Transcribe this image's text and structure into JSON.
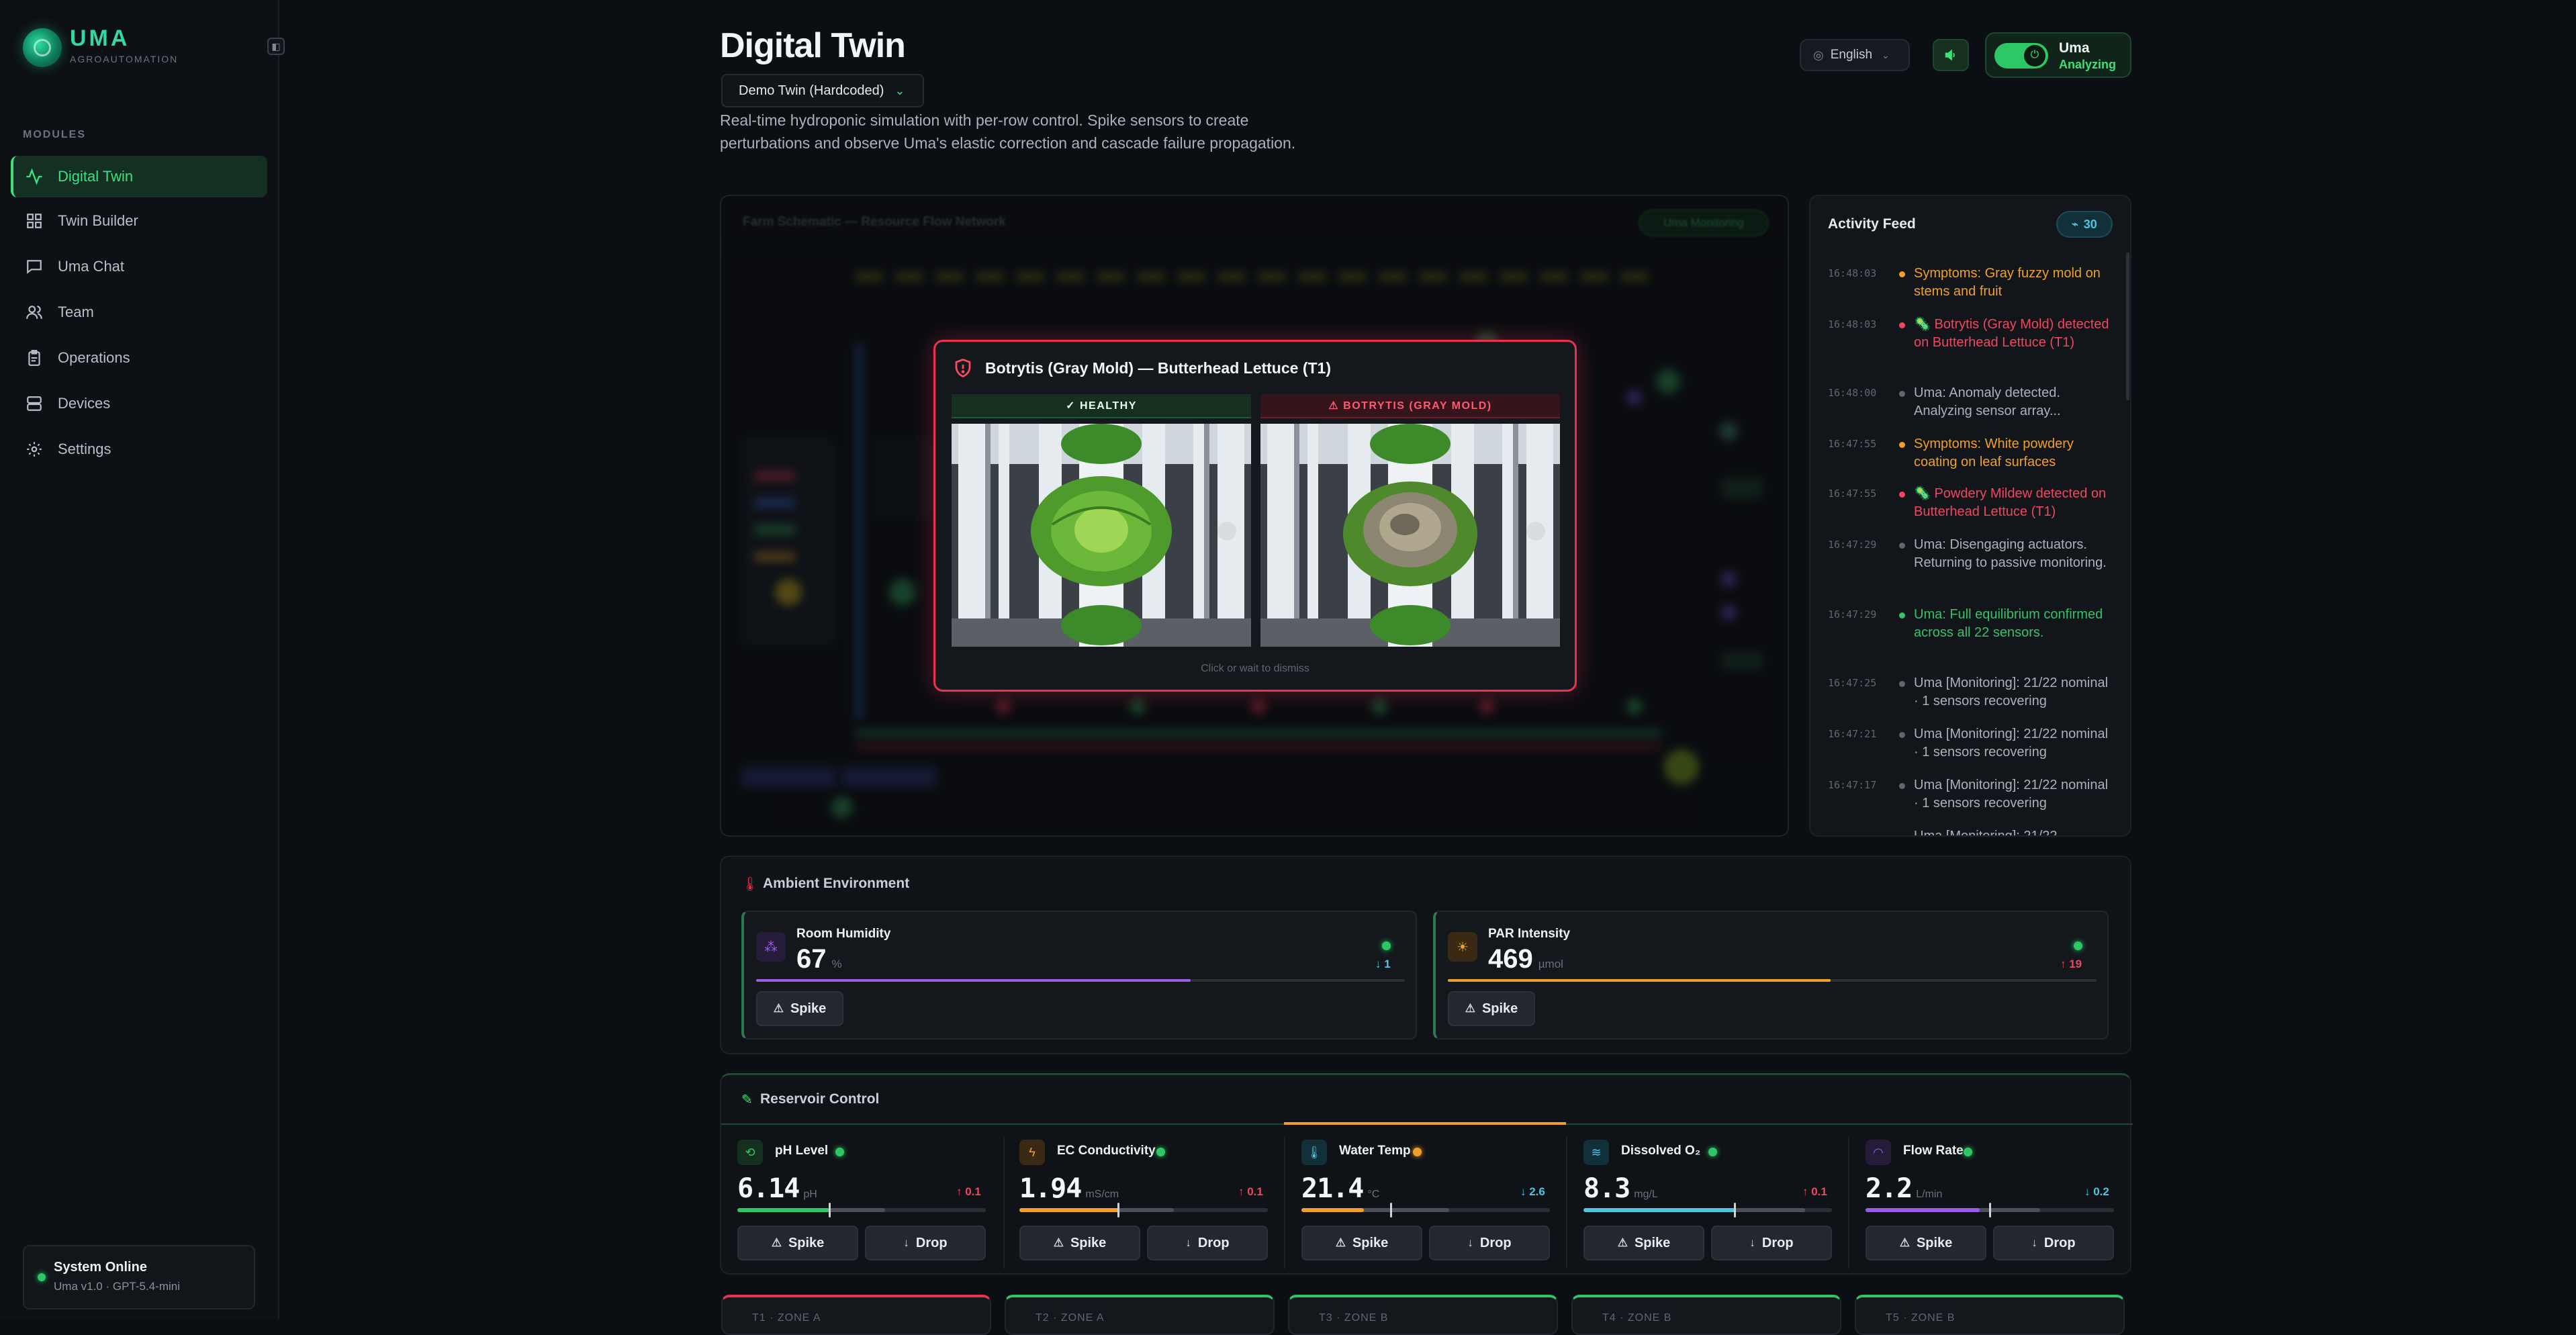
{
  "brand": {
    "name": "UMA",
    "subtitle": "AGROAUTOMATION"
  },
  "sidebar": {
    "section_label": "MODULES",
    "items": [
      {
        "label": "Digital Twin",
        "icon": "activity-icon"
      },
      {
        "label": "Twin Builder",
        "icon": "grid-icon"
      },
      {
        "label": "Uma Chat",
        "icon": "chat-icon"
      },
      {
        "label": "Team",
        "icon": "users-icon"
      },
      {
        "label": "Operations",
        "icon": "clipboard-icon"
      },
      {
        "label": "Devices",
        "icon": "server-icon"
      },
      {
        "label": "Settings",
        "icon": "gear-icon"
      }
    ],
    "system": {
      "title": "System Online",
      "version": "Uma v1.0 · GPT-5.4-mini"
    }
  },
  "header": {
    "title": "Digital Twin",
    "twin_select": "Demo Twin (Hardcoded)",
    "description": "Real-time hydroponic simulation with per-row control. Spike sensors to create perturbations and observe Uma's elastic correction and cascade failure propagation.",
    "language": "English",
    "uma": {
      "name": "Uma",
      "status": "Analyzing"
    }
  },
  "schematic": {
    "title": "Farm Schematic — Resource Flow Network",
    "badge": "Uma Monitoring"
  },
  "modal": {
    "title": "Botrytis (Gray Mold) — Butterhead Lettuce (T1)",
    "healthy_tag": "✓ HEALTHY",
    "disease_tag": "⚠ BOTRYTIS (GRAY MOLD)",
    "hint": "Click or wait to dismiss"
  },
  "feed": {
    "title": "Activity Feed",
    "count": "30",
    "items": [
      {
        "time": "16:48:03",
        "text": "Symptoms: Gray fuzzy mold on stems and fruit",
        "color": "#f0a02a"
      },
      {
        "time": "16:48:03",
        "text": "🦠 Botrytis (Gray Mold) detected on Butterhead Lettuce (T1)",
        "color": "#f0465e"
      },
      {
        "time": "16:48:00",
        "text": "Uma: Anomaly detected. Analyzing sensor array...",
        "color": "#aab1ba"
      },
      {
        "time": "16:47:55",
        "text": "Symptoms: White powdery coating on leaf surfaces",
        "color": "#f0a02a"
      },
      {
        "time": "16:47:55",
        "text": "🦠 Powdery Mildew detected on Butterhead Lettuce (T1)",
        "color": "#f0465e"
      },
      {
        "time": "16:47:29",
        "text": "Uma: Disengaging actuators. Returning to passive monitoring.",
        "color": "#aab1ba"
      },
      {
        "time": "16:47:29",
        "text": "Uma: Full equilibrium confirmed across all 22 sensors.",
        "color": "#35c26a"
      },
      {
        "time": "16:47:25",
        "text": "Uma [Monitoring]: 21/22 nominal · 1 sensors recovering",
        "color": "#aab1ba"
      },
      {
        "time": "16:47:21",
        "text": "Uma [Monitoring]: 21/22 nominal · 1 sensors recovering",
        "color": "#aab1ba"
      },
      {
        "time": "16:47:17",
        "text": "Uma [Monitoring]: 21/22 nominal · 1 sensors recovering",
        "color": "#aab1ba"
      },
      {
        "time": "",
        "text": "Uma [Monitoring]: 21/22",
        "color": "#aab1ba"
      }
    ]
  },
  "ambient": {
    "title": "Ambient Environment",
    "cards": [
      {
        "name": "Room Humidity",
        "value": "67",
        "unit": "%",
        "delta": "↓ 1",
        "delta_color": "#4ec6e0",
        "fill": 0.67,
        "bar_color": "#9b5de5",
        "icon": "humidity-icon",
        "spike": "Spike"
      },
      {
        "name": "PAR Intensity",
        "value": "469",
        "unit": "µmol",
        "delta": "↑ 19",
        "delta_color": "#f0465e",
        "fill": 0.59,
        "bar_color": "#f0a02a",
        "icon": "sun-icon",
        "spike": "Spike"
      }
    ]
  },
  "reservoir": {
    "title": "Reservoir Control",
    "cards": [
      {
        "name": "pH Level",
        "value": "6.14",
        "unit": "pH",
        "delta": "↑ 0.1",
        "delta_color": "#f0465e",
        "status_color": "#2ec765",
        "fill": 0.37,
        "bar_color": "#2ec765",
        "icon": "ph-icon",
        "spike": "Spike",
        "drop": "Drop"
      },
      {
        "name": "EC Conductivity",
        "value": "1.94",
        "unit": "mS/cm",
        "delta": "↑ 0.1",
        "delta_color": "#f0465e",
        "status_color": "#2ec765",
        "fill": 0.4,
        "bar_color": "#f0a02a",
        "icon": "bolt-icon",
        "spike": "Spike",
        "drop": "Drop"
      },
      {
        "name": "Water Temp",
        "value": "21.4",
        "unit": "°C",
        "delta": "↓ 2.6",
        "delta_color": "#4ec6e0",
        "status_color": "#f0a02a",
        "fill": 0.25,
        "bar_color": "#f0a02a",
        "icon": "thermometer-icon",
        "spike": "Spike",
        "drop": "Drop"
      },
      {
        "name": "Dissolved O₂",
        "value": "8.3",
        "unit": "mg/L",
        "delta": "↑ 0.1",
        "delta_color": "#f0465e",
        "status_color": "#2ec765",
        "fill": 0.61,
        "bar_color": "#4ec6e0",
        "icon": "waves-icon",
        "spike": "Spike",
        "drop": "Drop"
      },
      {
        "name": "Flow Rate",
        "value": "2.2",
        "unit": "L/min",
        "delta": "↓ 0.2",
        "delta_color": "#4ec6e0",
        "status_color": "#2ec765",
        "fill": 0.46,
        "bar_color": "#9b5de5",
        "icon": "gauge-icon",
        "spike": "Spike",
        "drop": "Drop"
      }
    ]
  },
  "zones": [
    {
      "label": "T1 · ZONE A",
      "color": "#e8324f"
    },
    {
      "label": "T2 · ZONE A",
      "color": "#2ec765"
    },
    {
      "label": "T3 · ZONE B",
      "color": "#2ec765"
    },
    {
      "label": "T4 · ZONE B",
      "color": "#2ec765"
    },
    {
      "label": "T5 · ZONE B",
      "color": "#2ec765"
    }
  ]
}
